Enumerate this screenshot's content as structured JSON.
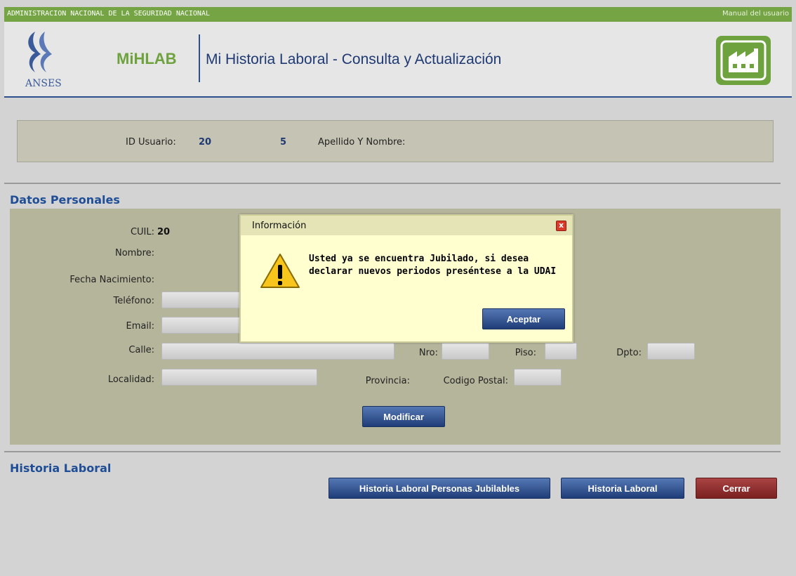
{
  "topbar": {
    "org": "ADMINISTRACION NACIONAL DE LA SEGURIDAD NACIONAL",
    "manual_link": "Manual del usuario"
  },
  "header": {
    "logo_text": "ANSES",
    "app_name": "MiHLAB",
    "app_subtitle": "Mi Historia Laboral - Consulta y Actualización",
    "factory_icon": "factory-icon"
  },
  "user": {
    "id_label": "ID Usuario:",
    "id_prefix": "20",
    "id_suffix": "5",
    "name_label": "Apellido Y Nombre:"
  },
  "personal": {
    "section_title": "Datos Personales",
    "cuil_label": "CUIL:",
    "cuil_value": "20",
    "nombre_label": "Nombre:",
    "fecha_label": "Fecha Nacimiento:",
    "telefono_label": "Teléfono:",
    "email_label": "Email:",
    "calle_label": "Calle:",
    "nro_label": "Nro:",
    "piso_label": "Piso:",
    "dpto_label": "Dpto:",
    "localidad_label": "Localidad:",
    "provincia_label": "Provincia:",
    "cp_label": "Codigo Postal:",
    "modificar_label": "Modificar"
  },
  "history": {
    "section_title": "Historia Laboral",
    "btn_jubilables": "Historia Laboral Personas Jubilables",
    "btn_historia": "Historia Laboral",
    "btn_cerrar": "Cerrar"
  },
  "dialog": {
    "title": "Información",
    "close_glyph": "x",
    "message": "Usted ya se encuentra Jubilado, si desea declarar nuevos periodos preséntese a la UDAI",
    "accept_label": "Aceptar"
  },
  "colors": {
    "topbar_green": "#74a443",
    "brand_blue": "#1f3a73",
    "panel_olive": "#b5b59c",
    "dialog_bg": "#ffffcf",
    "close_red": "#d93a2a"
  }
}
